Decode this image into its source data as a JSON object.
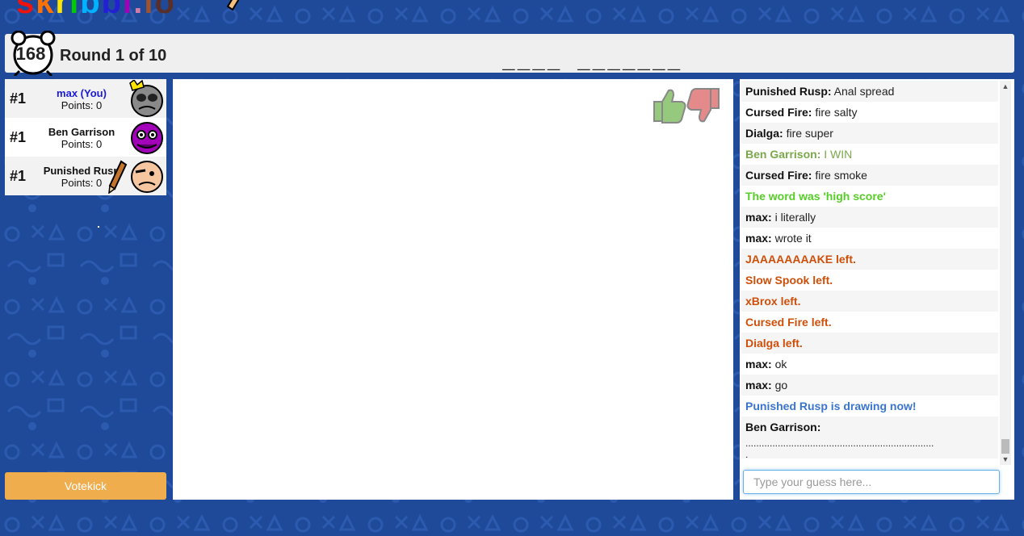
{
  "logo": {
    "text": "skribbl.io"
  },
  "header": {
    "timer": "168",
    "round": "Round 1 of 10",
    "word_hint": "____ _______"
  },
  "players": [
    {
      "rank": "#1",
      "name": "max (You)",
      "points": "Points: 0",
      "is_you": true,
      "crown": true
    },
    {
      "rank": "#1",
      "name": "Ben Garrison",
      "points": "Points: 0"
    },
    {
      "rank": "#1",
      "name": "Punished Rusp",
      "points": "Points: 0",
      "drawing": true
    }
  ],
  "votekick": {
    "label": "Votekick"
  },
  "canvas": {
    "like_icon": "thumbs-up-icon",
    "dislike_icon": "thumbs-down-icon"
  },
  "chat": {
    "messages": [
      {
        "user": "Punished Rusp:",
        "text": " Anal spread",
        "type": "normal"
      },
      {
        "user": "Cursed Fire:",
        "text": " fire salty",
        "type": "normal"
      },
      {
        "user": "Dialga:",
        "text": " fire super",
        "type": "normal"
      },
      {
        "user": "Ben Garrison:",
        "text": " I WIN",
        "type": "green-user"
      },
      {
        "user": "Cursed Fire:",
        "text": " fire smoke",
        "type": "normal"
      },
      {
        "user": "",
        "text": "The word was 'high score'",
        "type": "word-reveal"
      },
      {
        "user": "max:",
        "text": " i literally",
        "type": "normal"
      },
      {
        "user": "max:",
        "text": " wrote it",
        "type": "normal"
      },
      {
        "user": "",
        "text": "JAAAAAAAAKE left.",
        "type": "left"
      },
      {
        "user": "",
        "text": "Slow Spook left.",
        "type": "left"
      },
      {
        "user": "",
        "text": "xBrox left.",
        "type": "left"
      },
      {
        "user": "",
        "text": "Cursed Fire left.",
        "type": "left"
      },
      {
        "user": "",
        "text": "Dialga left.",
        "type": "left"
      },
      {
        "user": "max:",
        "text": " ok",
        "type": "normal"
      },
      {
        "user": "max:",
        "text": " go",
        "type": "normal"
      },
      {
        "user": "",
        "text": "Punished Rusp is drawing now!",
        "type": "drawing"
      },
      {
        "user": "Ben Garrison:",
        "text": "",
        "type": "normal",
        "extra": "......................................................................",
        "extra2": "."
      }
    ],
    "input_placeholder": "Type your guess here..."
  },
  "colors": {
    "background": "#1f4a9a",
    "left_message": "#ce4f0a",
    "word_reveal": "#56ce27",
    "drawing_notice": "#3975ce",
    "votekick": "#f0ad4e"
  }
}
